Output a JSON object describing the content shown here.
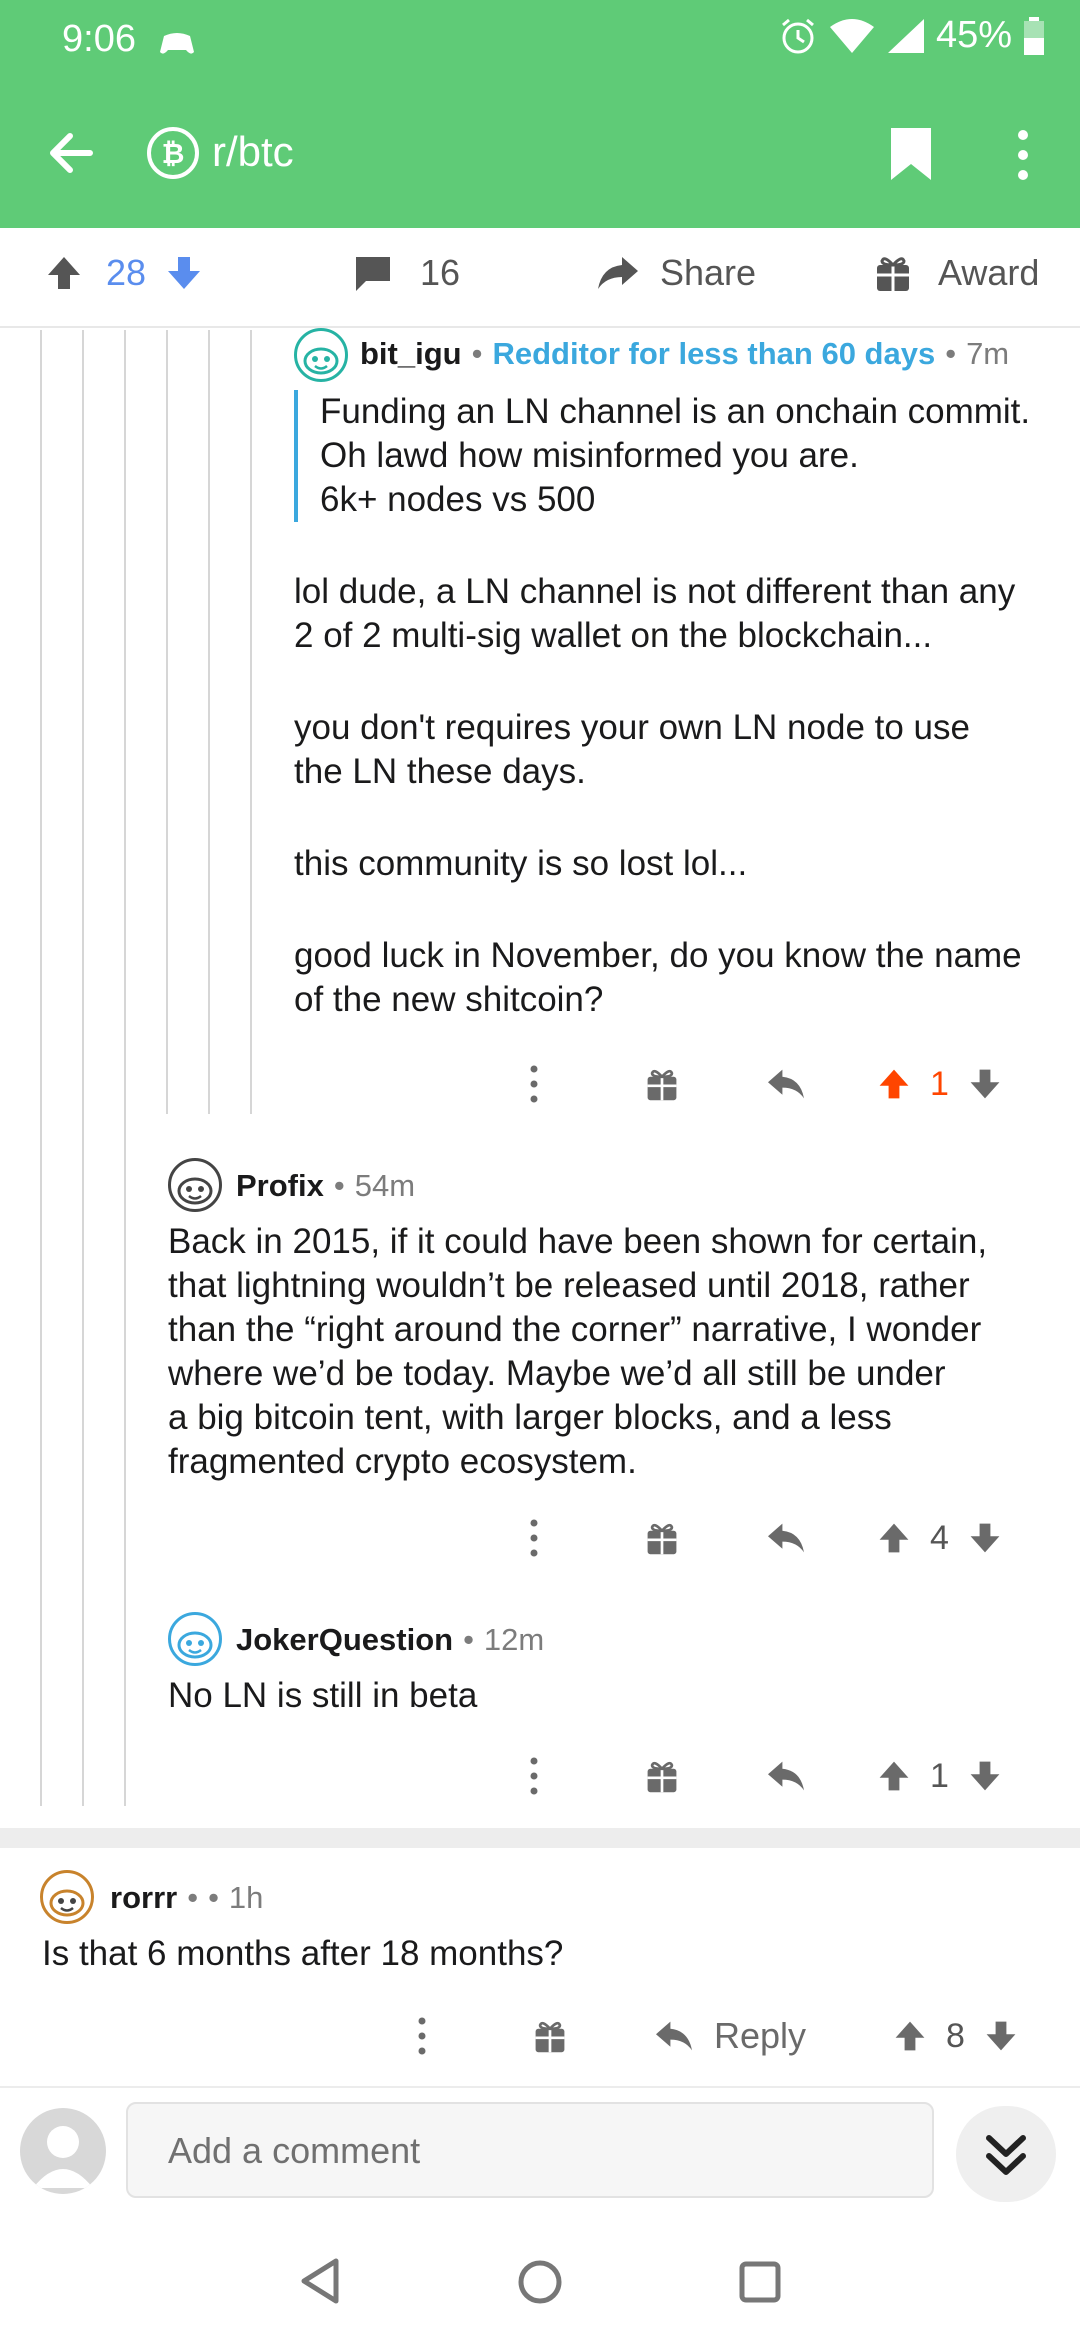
{
  "status": {
    "time": "9:06",
    "battery": "45%"
  },
  "app": {
    "subreddit": "r/btc"
  },
  "post_actions": {
    "upvotes": "28",
    "comments": "16",
    "share": "Share",
    "award": "Award"
  },
  "comments": [
    {
      "author": "bit_igu",
      "flair": "Redditor for less than 60 days",
      "age": "7m",
      "quote_lines": [
        "Funding an LN channel is an onchain commit.",
        "Oh lawd how misinformed you are.",
        "6k+ nodes vs 500"
      ],
      "paragraphs": [
        [
          "lol dude, a LN channel is not different than any",
          "2 of 2  multi-sig wallet on the blockchain..."
        ],
        [
          "you don't requires your own LN node to use",
          "the LN these days."
        ],
        [
          "this community is so lost lol..."
        ],
        [
          "good luck in November, do you know the name",
          "of the new shitcoin?"
        ]
      ],
      "score": "1"
    },
    {
      "author": "Profix",
      "age": "54m",
      "lines": [
        "Back in 2015, if it could have been shown for certain,",
        "that lightning wouldn’t be released until 2018, rather",
        "than the “right around the corner” narrative, I wonder",
        "where we’d be today. Maybe we’d all still be under",
        "a big bitcoin tent, with larger blocks, and a less",
        "fragmented crypto ecosystem."
      ],
      "score": "4"
    },
    {
      "author": "JokerQuestion",
      "age": "12m",
      "lines": [
        "No LN is still in beta"
      ],
      "score": "1"
    },
    {
      "author": "rorrr",
      "age": "1h",
      "lines": [
        "Is that 6 months after 18 months?"
      ],
      "reply": "Reply",
      "score": "8"
    }
  ],
  "composer": {
    "placeholder": "Add a comment"
  },
  "colors": {
    "brand": "#5fcb77",
    "upvote": "#ff4500",
    "blue": "#3ba8de",
    "postvote": "#5a8dee"
  }
}
